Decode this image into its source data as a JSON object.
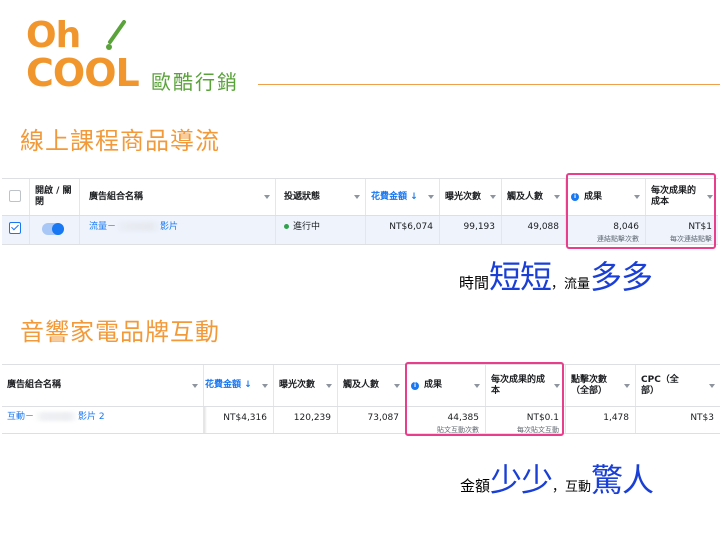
{
  "logo": {
    "top_text": "Oh",
    "bottom_text": "COOL",
    "chinese_name": "歐酷行銷",
    "brand_color": "#f0962d",
    "accent_color": "#5aa33a"
  },
  "section1": {
    "title": "線上課程商品導流",
    "table": {
      "headers": {
        "toggle": "開啟 / 關閉",
        "name": "廣告組合名稱",
        "status": "投遞狀態",
        "spend": "花費金額 ↓",
        "impressions": "曝光次數",
        "reach": "觸及人數",
        "results": "成果",
        "cost_per_result": "每次成果的成本"
      },
      "row": {
        "name_prefix": "流量－",
        "name_suffix": "影片",
        "status": "進行中",
        "spend": "NT$6,074",
        "impressions": "99,193",
        "reach": "49,088",
        "results": "8,046",
        "results_sub": "連結點擊次數",
        "cost_per_result": "NT$1",
        "cost_sub": "每次連結點擊",
        "checked": true,
        "toggle_on": true
      }
    },
    "caption": {
      "a": "時間",
      "b": "短短",
      "c": "，流量",
      "d": "多多"
    }
  },
  "section2": {
    "title": "音響家電品牌互動",
    "table": {
      "headers": {
        "name": "廣告組合名稱",
        "spend": "花費金額 ↓",
        "impressions": "曝光次數",
        "reach": "觸及人數",
        "results": "成果",
        "cost_per_result": "每次成果的成本",
        "clicks_all": "點擊次數（全部）",
        "cpc_all": "CPC（全部）"
      },
      "row": {
        "name_prefix": "互動－",
        "name_suffix": "影片 2",
        "spend": "NT$4,316",
        "impressions": "120,239",
        "reach": "73,087",
        "results": "44,385",
        "results_sub": "貼文互動次數",
        "cost_per_result": "NT$0.1",
        "cost_sub": "每次貼文互動",
        "clicks_all": "1,478",
        "cpc_all": "NT$3"
      }
    },
    "caption": {
      "a": "金額",
      "b": "少少",
      "c": "，互動",
      "d": "驚人"
    }
  },
  "colors": {
    "section_title": "#f29a3a",
    "highlight": "#e83e8c",
    "caption_big": "#1a3fd6",
    "link": "#1877f2",
    "active_status": "#31a24c"
  }
}
